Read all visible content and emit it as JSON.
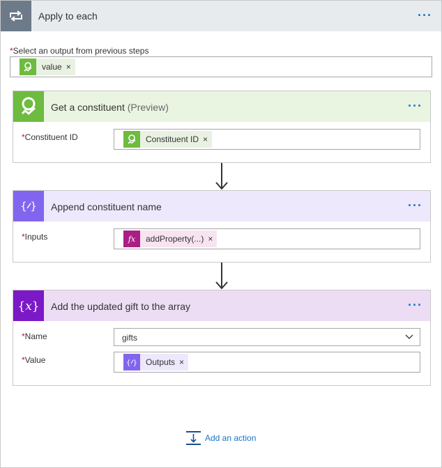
{
  "header": {
    "title": "Apply to each",
    "more": "···"
  },
  "select_output": {
    "label": "Select an output from previous steps",
    "token": "value"
  },
  "cards": [
    {
      "title": "Get a constituent",
      "title_suffix": "(Preview)",
      "header_color": "#e9f5e1",
      "icon_color": "#6dbb3f",
      "fields": [
        {
          "label": "Constituent ID",
          "token": "Constituent ID"
        }
      ]
    },
    {
      "title": "Append constituent name",
      "header_color": "#ede8fb",
      "icon_color": "#8265ee",
      "fields": [
        {
          "label": "Inputs",
          "token": "addProperty(...)"
        }
      ]
    },
    {
      "title": "Add the updated gift to the array",
      "header_color": "#ecddf5",
      "icon_color": "#7b19c7",
      "fields": [
        {
          "label": "Name",
          "value": "gifts"
        },
        {
          "label": "Value",
          "token": "Outputs"
        }
      ]
    }
  ],
  "add_action": {
    "label": "Add an action"
  },
  "token_remove": "×",
  "required_mark": "*"
}
